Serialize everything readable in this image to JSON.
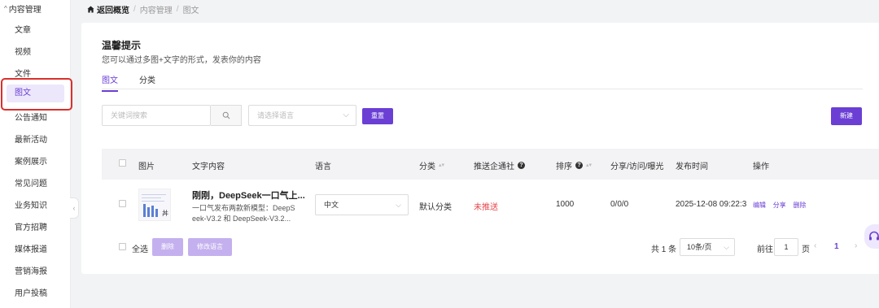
{
  "sidebar": {
    "group_label": "内容管理",
    "items": [
      {
        "label": "文章",
        "active": false
      },
      {
        "label": "视频",
        "active": false
      },
      {
        "label": "文件",
        "active": false
      },
      {
        "label": "图文",
        "active": true
      },
      {
        "label": "公告通知",
        "active": false
      },
      {
        "label": "最新活动",
        "active": false
      },
      {
        "label": "案例展示",
        "active": false
      },
      {
        "label": "常见问题",
        "active": false
      },
      {
        "label": "业务知识",
        "active": false
      },
      {
        "label": "官方招聘",
        "active": false
      },
      {
        "label": "媒体报道",
        "active": false
      },
      {
        "label": "营销海报",
        "active": false
      },
      {
        "label": "用户投稿",
        "active": false
      }
    ]
  },
  "breadcrumb": {
    "home": "返回概览",
    "level1": "内容管理",
    "level2": "图文"
  },
  "tip": {
    "title": "温馨提示",
    "desc": "您可以通过多图+文字的形式，发表你的内容"
  },
  "tabs": [
    {
      "label": "图文",
      "active": true
    },
    {
      "label": "分类",
      "active": false
    }
  ],
  "filters": {
    "search_placeholder": "关键词搜索",
    "lang_placeholder": "请选择语言",
    "reset_label": "重置",
    "new_label": "新建"
  },
  "table": {
    "headers": {
      "image": "图片",
      "content": "文字内容",
      "lang": "语言",
      "category": "分类",
      "push": "推送企通社",
      "order": "排序",
      "stats": "分享/访问/曝光",
      "time": "发布时间",
      "actions": "操作"
    },
    "rows": [
      {
        "title": "刚刚，DeepSeek一口气上...",
        "body_line1": "一口气发布两款新模型：DeepS",
        "body_line2": "eek-V3.2 和 DeepSeek-V3.2...",
        "lang": "中文",
        "category": "默认分类",
        "push_status": "未推送",
        "order": "1000",
        "stats": "0/0/0",
        "time": "2025-12-08 09:22:3",
        "actions": [
          "编辑",
          "分享",
          "删除"
        ]
      }
    ]
  },
  "footer": {
    "select_all": "全选",
    "delete_label": "删除",
    "edit_lang_label": "修改语言",
    "total": "共 1 条",
    "page_size": "10条/页",
    "goto_label": "前往",
    "goto_value": "1",
    "page_suffix": "页",
    "current_page": "1"
  },
  "colors": {
    "accent": "#6b3fd4",
    "status_red": "#e5484d",
    "highlight_box": "#d9302c"
  }
}
